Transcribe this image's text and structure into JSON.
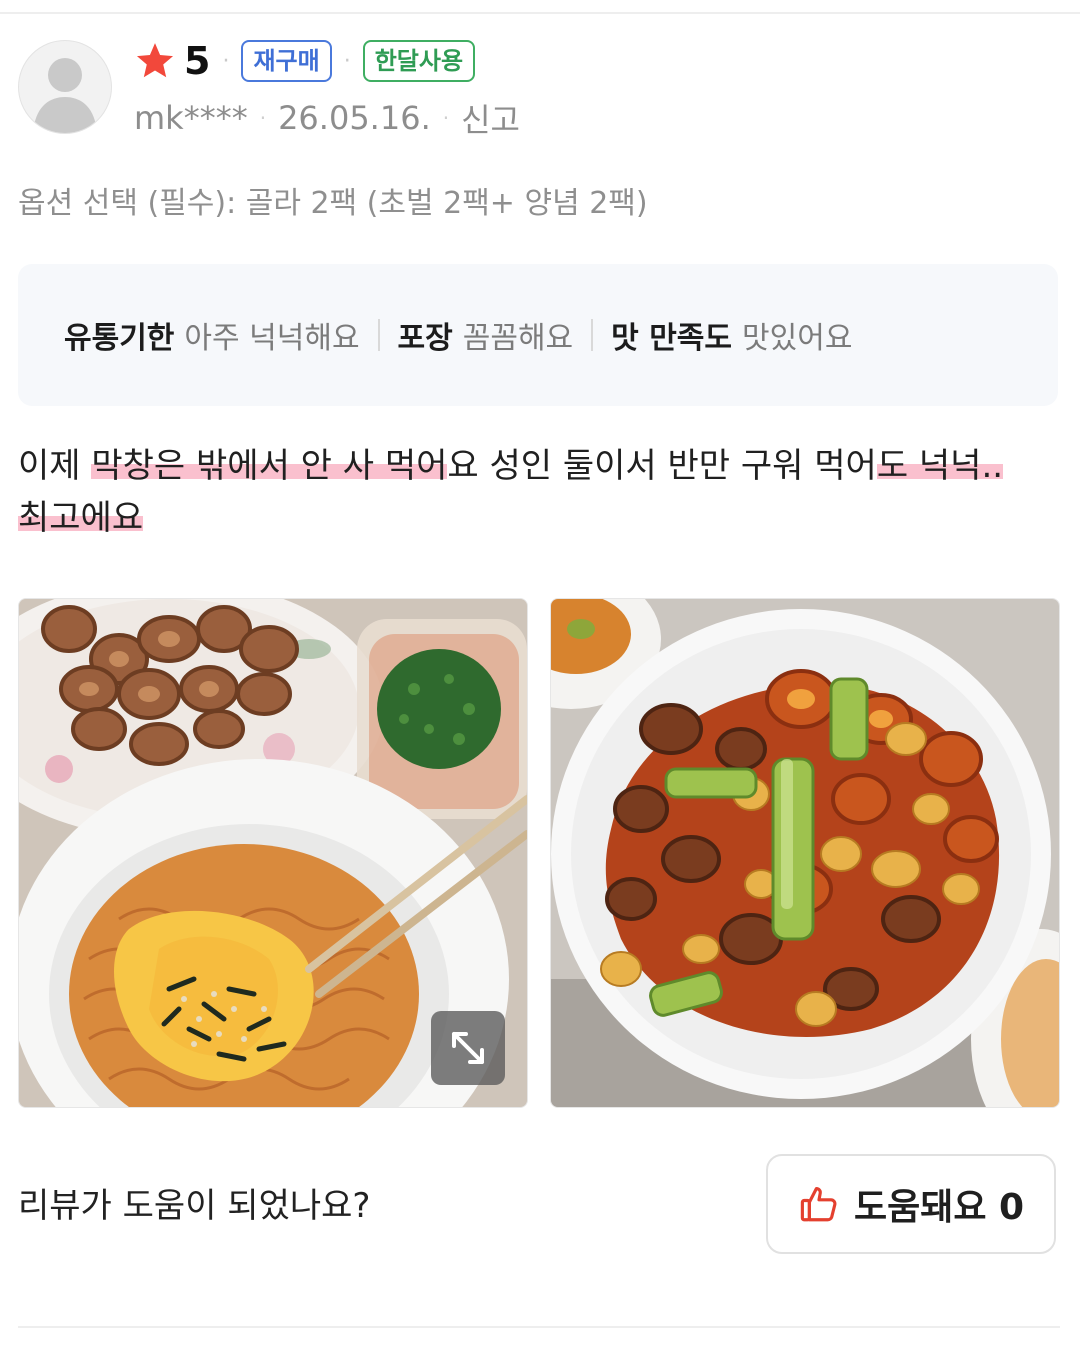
{
  "review": {
    "rating": "5",
    "badges": [
      "재구매",
      "한달사용"
    ],
    "user": "mk****",
    "date": "26.05.16.",
    "report_label": "신고",
    "option_label": "옵션 선택 (필수): 골라 2팩 (초벌 2팩+ 양념 2팩)",
    "summary": [
      {
        "key": "유통기한",
        "value": "아주 넉넉해요"
      },
      {
        "key": "포장",
        "value": "꼼꼼해요"
      },
      {
        "key": "맛 만족도",
        "value": "맛있어요"
      }
    ],
    "text": {
      "p1": "이제 ",
      "p2": "막창은 밖에서 안 사 먹어",
      "p3": "요 성인 둘이서 반만 구워 먹어",
      "p4": "도 넉넉..",
      "p5": "최고에요"
    }
  },
  "photos": {
    "count": 2,
    "expand_icon": "expand-arrows-icon"
  },
  "helpful": {
    "question": "리뷰가 도움이 되었나요?",
    "button_label": "도움돼요 0",
    "icon": "thumbs-up-icon"
  },
  "colors": {
    "star": "#f2483b",
    "badge_blue": "#3f6fd6",
    "badge_green": "#2f9c54",
    "highlight": "#f58ca5",
    "thumb": "#e4402f",
    "summary_bg": "#f6f8fb"
  }
}
